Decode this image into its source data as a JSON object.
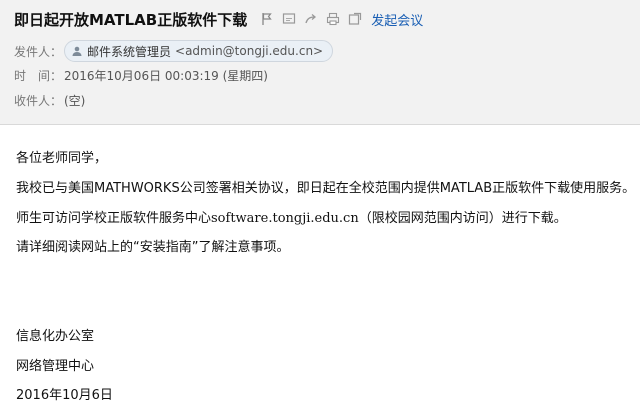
{
  "mail": {
    "subject": "即日起开放MATLAB正版软件下载",
    "toolbar": {
      "icons": [
        "flag-icon",
        "reply-icon",
        "forward-icon",
        "print-icon",
        "new-window-icon"
      ],
      "meeting_label": "发起会议"
    },
    "from_label": "发件人：",
    "from_name": "邮件系统管理员",
    "from_address": "<admin@tongji.edu.cn>",
    "time_label": "时　间：",
    "time_value": "2016年10月06日 00:03:19 (星期四)",
    "to_label": "收件人：",
    "to_value": "(空)"
  },
  "body": {
    "greeting": "各位老师同学，",
    "para1": "我校已与美国MATHWORKS公司签署相关协议，即日起在全校范围内提供MATLAB正版软件下载使用服务。",
    "para2_a": "师生可访问学校正版软件服务中心",
    "para2_link": "software.tongji.edu.cn",
    "para2_b": "（限校园网范围内访问）进行下载。",
    "para3": "请详细阅读网站上的“安装指南”了解注意事项。",
    "signature_dept": "信息化办公室",
    "signature_center": "网络管理中心",
    "signature_date": "2016年10月6日"
  }
}
